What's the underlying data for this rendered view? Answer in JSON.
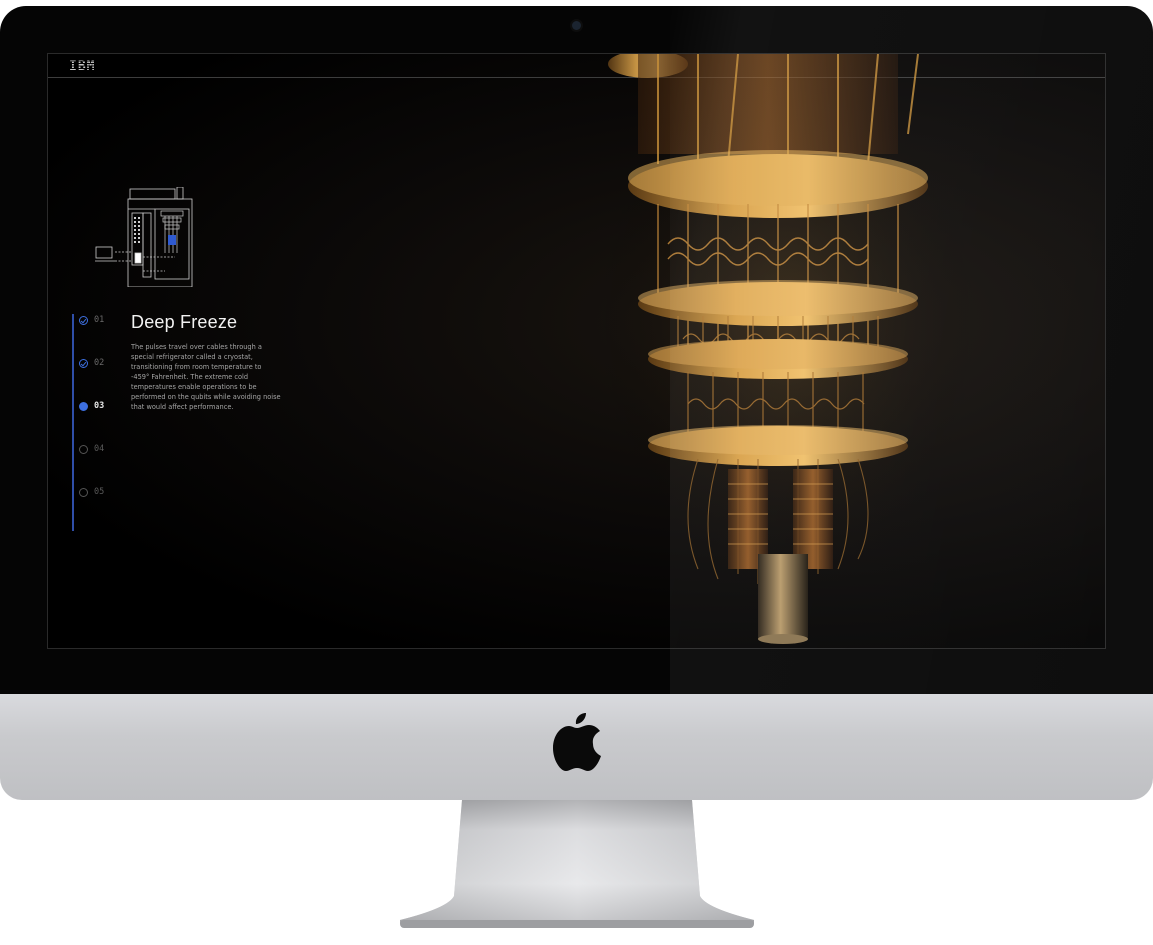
{
  "brand": {
    "logo_text": "IBM"
  },
  "content": {
    "title": "Deep Freeze",
    "description": "The pulses travel over cables through a special refrigerator called a cryostat, transitioning from room temperature to -459° Fahrenheit. The extreme cold temperatures enable operations to be performed on the qubits while avoiding noise that would affect performance."
  },
  "steps": [
    {
      "label": "01",
      "state": "done"
    },
    {
      "label": "02",
      "state": "done"
    },
    {
      "label": "03",
      "state": "active"
    },
    {
      "label": "04",
      "state": "upcoming"
    },
    {
      "label": "05",
      "state": "upcoming"
    }
  ],
  "colors": {
    "accent": "#3d6fe0",
    "screen_background": "#000000",
    "bezel": "#050505",
    "chin": "#c9cacd",
    "cryostat_gold": "#c8913a"
  },
  "icons": {
    "device": "monitor-bezel",
    "chin_logo": "apple-logo-icon",
    "diagram": "quantum-system-diagram-icon"
  }
}
